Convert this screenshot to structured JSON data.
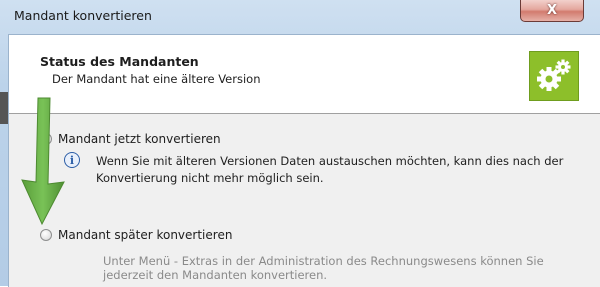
{
  "window": {
    "title": "Mandant konvertieren",
    "close_glyph": "X"
  },
  "header": {
    "title": "Status des Mandanten",
    "subtitle": "Der Mandant hat eine ältere Version",
    "icon": "gears-icon",
    "accent_color": "#8dbf2a"
  },
  "options": {
    "now": {
      "label": "Mandant jetzt konvertieren",
      "info": "Wenn Sie mit älteren Versionen Daten austauschen möchten, kann dies nach der Konvertierung nicht mehr möglich sein."
    },
    "later": {
      "label": "Mandant später konvertieren",
      "description": "Unter Menü - Extras in der Administration des Rechnungswesens können Sie jederzeit den Mandanten konvertieren."
    }
  },
  "annotation": {
    "arrow_color": "#6ab04c",
    "icon": "green-arrow-down"
  }
}
